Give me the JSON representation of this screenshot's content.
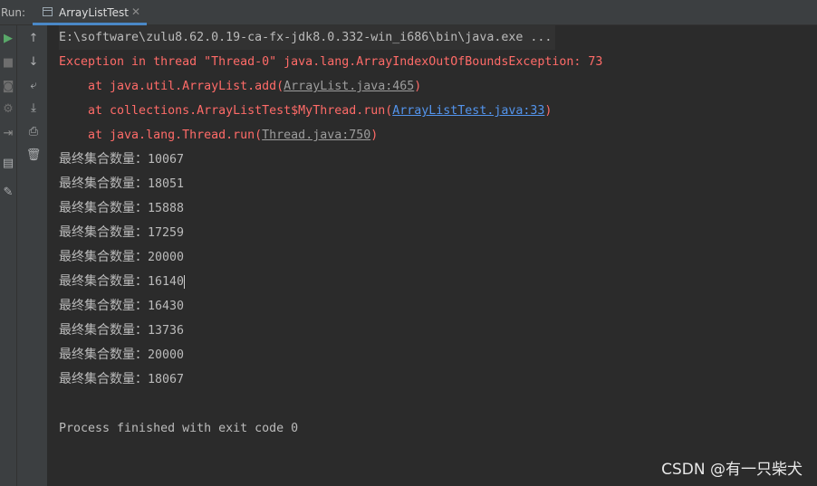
{
  "run_panel": {
    "label": "Run:",
    "tab": {
      "title": "ArrayListTest",
      "close_glyph": "✕"
    }
  },
  "left_toolbar": [
    {
      "name": "rerun-icon",
      "glyph": "▶",
      "color": "#59a869"
    },
    {
      "name": "stop-icon",
      "glyph": "■",
      "color": "#6e6e6e"
    },
    {
      "name": "camera-icon",
      "glyph": "◙",
      "color": "#6e6e6e"
    },
    {
      "name": "settings-icon",
      "glyph": "⚙",
      "color": "#6e6e6e"
    },
    {
      "name": "exit-icon",
      "glyph": "⇥",
      "color": "#8c8c8c"
    },
    {
      "name": "layout-icon",
      "glyph": "▤",
      "color": "#afb1b3"
    },
    {
      "name": "pin-icon",
      "glyph": "✎",
      "color": "#afb1b3"
    }
  ],
  "mid_toolbar": [
    {
      "name": "up-arrow-icon",
      "glyph": "↑"
    },
    {
      "name": "down-arrow-icon",
      "glyph": "↓"
    },
    {
      "name": "soft-wrap-icon",
      "glyph": "⤶"
    },
    {
      "name": "scroll-to-end-icon",
      "glyph": "⤓"
    },
    {
      "name": "print-icon",
      "glyph": "⎙"
    },
    {
      "name": "trash-icon",
      "glyph": "🗑"
    }
  ],
  "console": {
    "command": "E:\\software\\zulu8.62.0.19-ca-fx-jdk8.0.332-win_i686\\bin\\java.exe ...",
    "exception": "Exception in thread \"Thread-0\" java.lang.ArrayIndexOutOfBoundsException: 73",
    "stack": [
      {
        "prefix": "    at java.util.ArrayList.add(",
        "link": "ArrayList.java:465",
        "suffix": ")",
        "link_style": "grey"
      },
      {
        "prefix": "    at collections.ArrayListTest$MyThread.run(",
        "link": "ArrayListTest.java:33",
        "suffix": ")",
        "link_style": "blue"
      },
      {
        "prefix": "    at java.lang.Thread.run(",
        "link": "Thread.java:750",
        "suffix": ")",
        "link_style": "grey"
      }
    ],
    "result_label": "最终集合数量：",
    "results": [
      "10067",
      "18051",
      "15888",
      "17259",
      "20000",
      "16140",
      "16430",
      "13736",
      "20000",
      "18067"
    ],
    "finish": "Process finished with exit code 0"
  },
  "watermark": "CSDN @有一只柴犬"
}
